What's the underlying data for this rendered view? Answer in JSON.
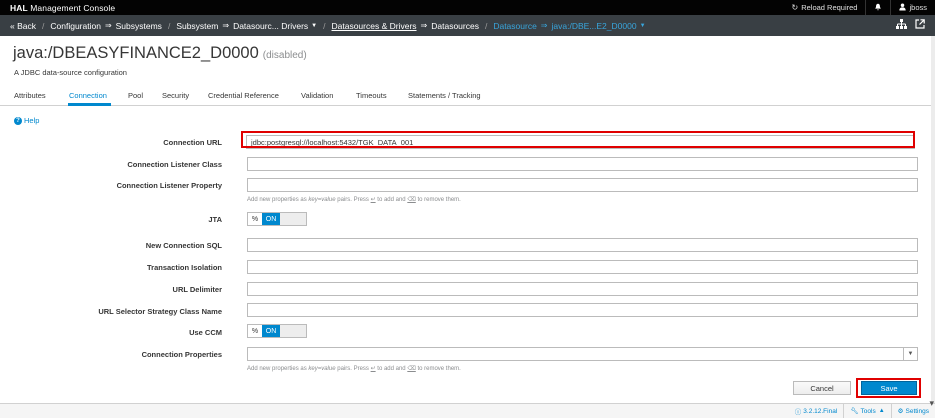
{
  "topbar": {
    "brand_bold": "HAL",
    "brand_rest": " Management Console",
    "reload_label": "Reload Required",
    "user_label": "jboss"
  },
  "breadcrumb": {
    "back": "« Back",
    "configuration": "Configuration",
    "subsystems": "Subsystems",
    "subsystem": "Subsystem",
    "subsystem_value": "Datasourc... Drivers",
    "datasources_drivers": "Datasources & Drivers",
    "datasources": "Datasources",
    "datasource": "Datasource",
    "datasource_value": "java:/DBE...E2_D0000"
  },
  "header": {
    "title": "java:/DBEASYFINANCE2_D0000",
    "title_suffix": "(disabled)",
    "description": "A JDBC data-source configuration"
  },
  "tabs": [
    "Attributes",
    "Connection",
    "Pool",
    "Security",
    "Credential Reference",
    "Validation",
    "Timeouts",
    "Statements / Tracking"
  ],
  "active_tab": "Connection",
  "help_label": "Help",
  "form": {
    "connection_url_label": "Connection URL",
    "connection_url_value": "jdbc:postgresql://localhost:5432/TGK_DATA_001",
    "listener_class_label": "Connection Listener Class",
    "listener_property_label": "Connection Listener Property",
    "help_prefix": "Add new properties as ",
    "help_em": "key=value",
    "help_mid": " pairs. Press ",
    "help_key1": "↵",
    "help_mid2": " to add and ",
    "help_key2": "⌫",
    "help_suffix": " to remove them.",
    "jta_label": "JTA",
    "jta_state": "ON",
    "new_connection_sql_label": "New Connection SQL",
    "transaction_isolation_label": "Transaction Isolation",
    "url_delimiter_label": "URL Delimiter",
    "url_selector_label": "URL Selector Strategy Class Name",
    "use_ccm_label": "Use CCM",
    "use_ccm_state": "ON",
    "connection_properties_label": "Connection Properties"
  },
  "buttons": {
    "cancel": "Cancel",
    "save": "Save"
  },
  "footer": {
    "version": "3.2.12.Final",
    "tools": "Tools",
    "settings": "Settings"
  },
  "colors": {
    "accent": "#0088ce",
    "highlight": "#e00000",
    "topbar": "#030303",
    "crumbbar": "#393f44"
  }
}
